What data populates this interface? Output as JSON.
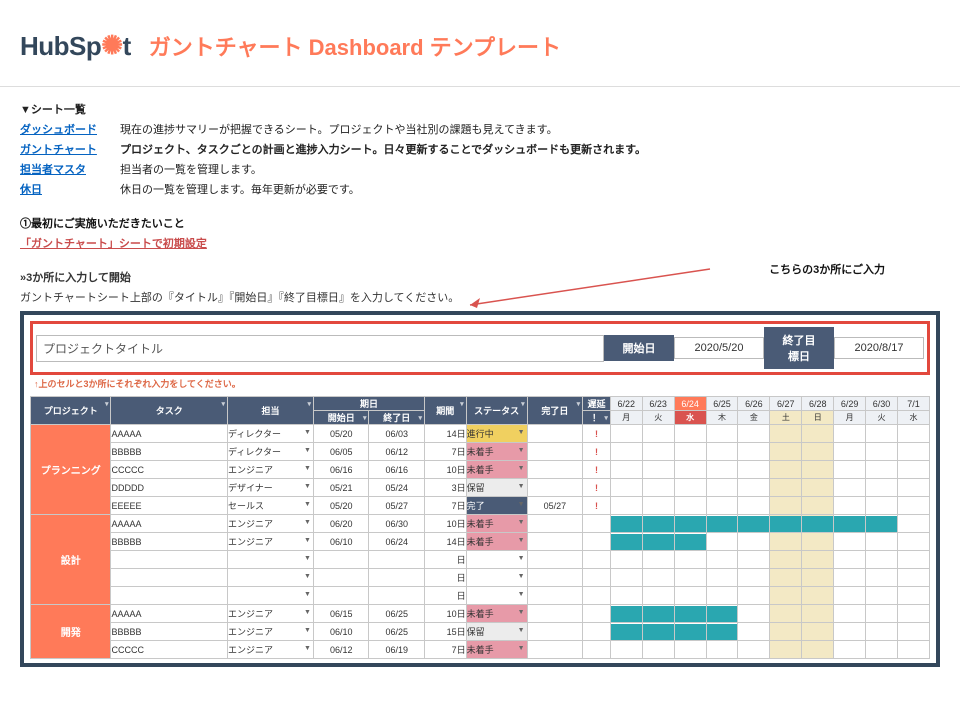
{
  "logo_parts": {
    "hub": "Hub",
    "sp": "Sp",
    "t": "t"
  },
  "page_title": "ガントチャート Dashboard テンプレート",
  "sheet_list_header": "▼シート一覧",
  "sheets": [
    {
      "name": "ダッシュボード",
      "desc": "現在の進捗サマリーが把握できるシート。プロジェクトや当社別の課題も見えてきます。",
      "bold": false
    },
    {
      "name": "ガントチャート",
      "desc": "プロジェクト、タスクごとの計画と進捗入力シート。日々更新することでダッシュボードも更新されます。",
      "bold": true
    },
    {
      "name": "担当者マスタ",
      "desc": "担当者の一覧を管理します。",
      "bold": false
    },
    {
      "name": "休日",
      "desc": "休日の一覧を管理します。毎年更新が必要です。",
      "bold": false
    }
  ],
  "step1_title": "①最初にご実施いただきたいこと",
  "step1_link": "「ガントチャート」シートで初期設定",
  "sub_title": "»3か所に入力して開始",
  "sub_desc": "ガントチャートシート上部の『タイトル』『開始日』『終了目標日』を入力してください。",
  "annotation": "こちらの3か所にご入力",
  "inputs": {
    "project_placeholder": "プロジェクトタイトル",
    "start_label": "開始日",
    "start_value": "2020/5/20",
    "end_label": "終了目標日",
    "end_value": "2020/8/17"
  },
  "columns": {
    "project": "プロジェクト",
    "task": "タスク",
    "assignee": "担当",
    "period_group": "期日",
    "start": "開始日",
    "end": "終了日",
    "duration": "期間",
    "status": "ステータス",
    "finish": "完了日",
    "delay_group": "遅延",
    "delay": "！"
  },
  "dates": [
    "6/22",
    "6/23",
    "6/24",
    "6/25",
    "6/26",
    "6/27",
    "6/28",
    "6/29",
    "6/30",
    "7/1"
  ],
  "dows": [
    "月",
    "火",
    "水",
    "木",
    "金",
    "土",
    "日",
    "月",
    "火",
    "水"
  ],
  "today_index": 2,
  "weekend_idx": [
    5,
    6
  ],
  "groups": [
    {
      "name": "プランニング",
      "rows": [
        {
          "task": "AAAAA",
          "assignee": "ディレクター",
          "start": "05/20",
          "end": "06/03",
          "dur": "14日",
          "status": "進行中",
          "stcls": "st-progress",
          "fin": "",
          "delay": "!",
          "bar": []
        },
        {
          "task": "BBBBB",
          "assignee": "ディレクター",
          "start": "06/05",
          "end": "06/12",
          "dur": "7日",
          "status": "未着手",
          "stcls": "st-notstart",
          "fin": "",
          "delay": "!",
          "bar": []
        },
        {
          "task": "CCCCC",
          "assignee": "エンジニア",
          "start": "06/16",
          "end": "06/16",
          "dur": "10日",
          "status": "未着手",
          "stcls": "st-notstart",
          "fin": "",
          "delay": "!",
          "bar": []
        },
        {
          "task": "DDDDD",
          "assignee": "デザイナー",
          "start": "05/21",
          "end": "05/24",
          "dur": "3日",
          "status": "保留",
          "stcls": "st-hold",
          "fin": "",
          "delay": "!",
          "bar": []
        },
        {
          "task": "EEEEE",
          "assignee": "セールス",
          "start": "05/20",
          "end": "05/27",
          "dur": "7日",
          "status": "完了",
          "stcls": "st-done",
          "fin": "05/27",
          "delay": "!",
          "bar": []
        }
      ]
    },
    {
      "name": "設計",
      "rows": [
        {
          "task": "AAAAA",
          "assignee": "エンジニア",
          "start": "06/20",
          "end": "06/30",
          "dur": "10日",
          "status": "未着手",
          "stcls": "st-notstart",
          "fin": "",
          "delay": "",
          "bar": [
            0,
            1,
            2,
            3,
            4,
            5,
            6,
            7,
            8
          ]
        },
        {
          "task": "BBBBB",
          "assignee": "エンジニア",
          "start": "06/10",
          "end": "06/24",
          "dur": "14日",
          "status": "未着手",
          "stcls": "st-notstart",
          "fin": "",
          "delay": "",
          "bar": [
            0,
            1,
            2
          ]
        },
        {
          "task": "",
          "assignee": "",
          "start": "",
          "end": "",
          "dur": "日",
          "status": "",
          "stcls": "",
          "fin": "",
          "delay": "",
          "bar": []
        },
        {
          "task": "",
          "assignee": "",
          "start": "",
          "end": "",
          "dur": "日",
          "status": "",
          "stcls": "",
          "fin": "",
          "delay": "",
          "bar": []
        },
        {
          "task": "",
          "assignee": "",
          "start": "",
          "end": "",
          "dur": "日",
          "status": "",
          "stcls": "",
          "fin": "",
          "delay": "",
          "bar": []
        }
      ]
    },
    {
      "name": "開発",
      "rows": [
        {
          "task": "AAAAA",
          "assignee": "エンジニア",
          "start": "06/15",
          "end": "06/25",
          "dur": "10日",
          "status": "未着手",
          "stcls": "st-notstart",
          "fin": "",
          "delay": "",
          "bar": [
            0,
            1,
            2,
            3
          ]
        },
        {
          "task": "BBBBB",
          "assignee": "エンジニア",
          "start": "06/10",
          "end": "06/25",
          "dur": "15日",
          "status": "保留",
          "stcls": "st-hold",
          "fin": "",
          "delay": "",
          "bar": [
            0,
            1,
            2,
            3
          ]
        },
        {
          "task": "CCCCC",
          "assignee": "エンジニア",
          "start": "06/12",
          "end": "06/19",
          "dur": "7日",
          "status": "未着手",
          "stcls": "st-notstart",
          "fin": "",
          "delay": "",
          "bar": []
        }
      ]
    }
  ]
}
